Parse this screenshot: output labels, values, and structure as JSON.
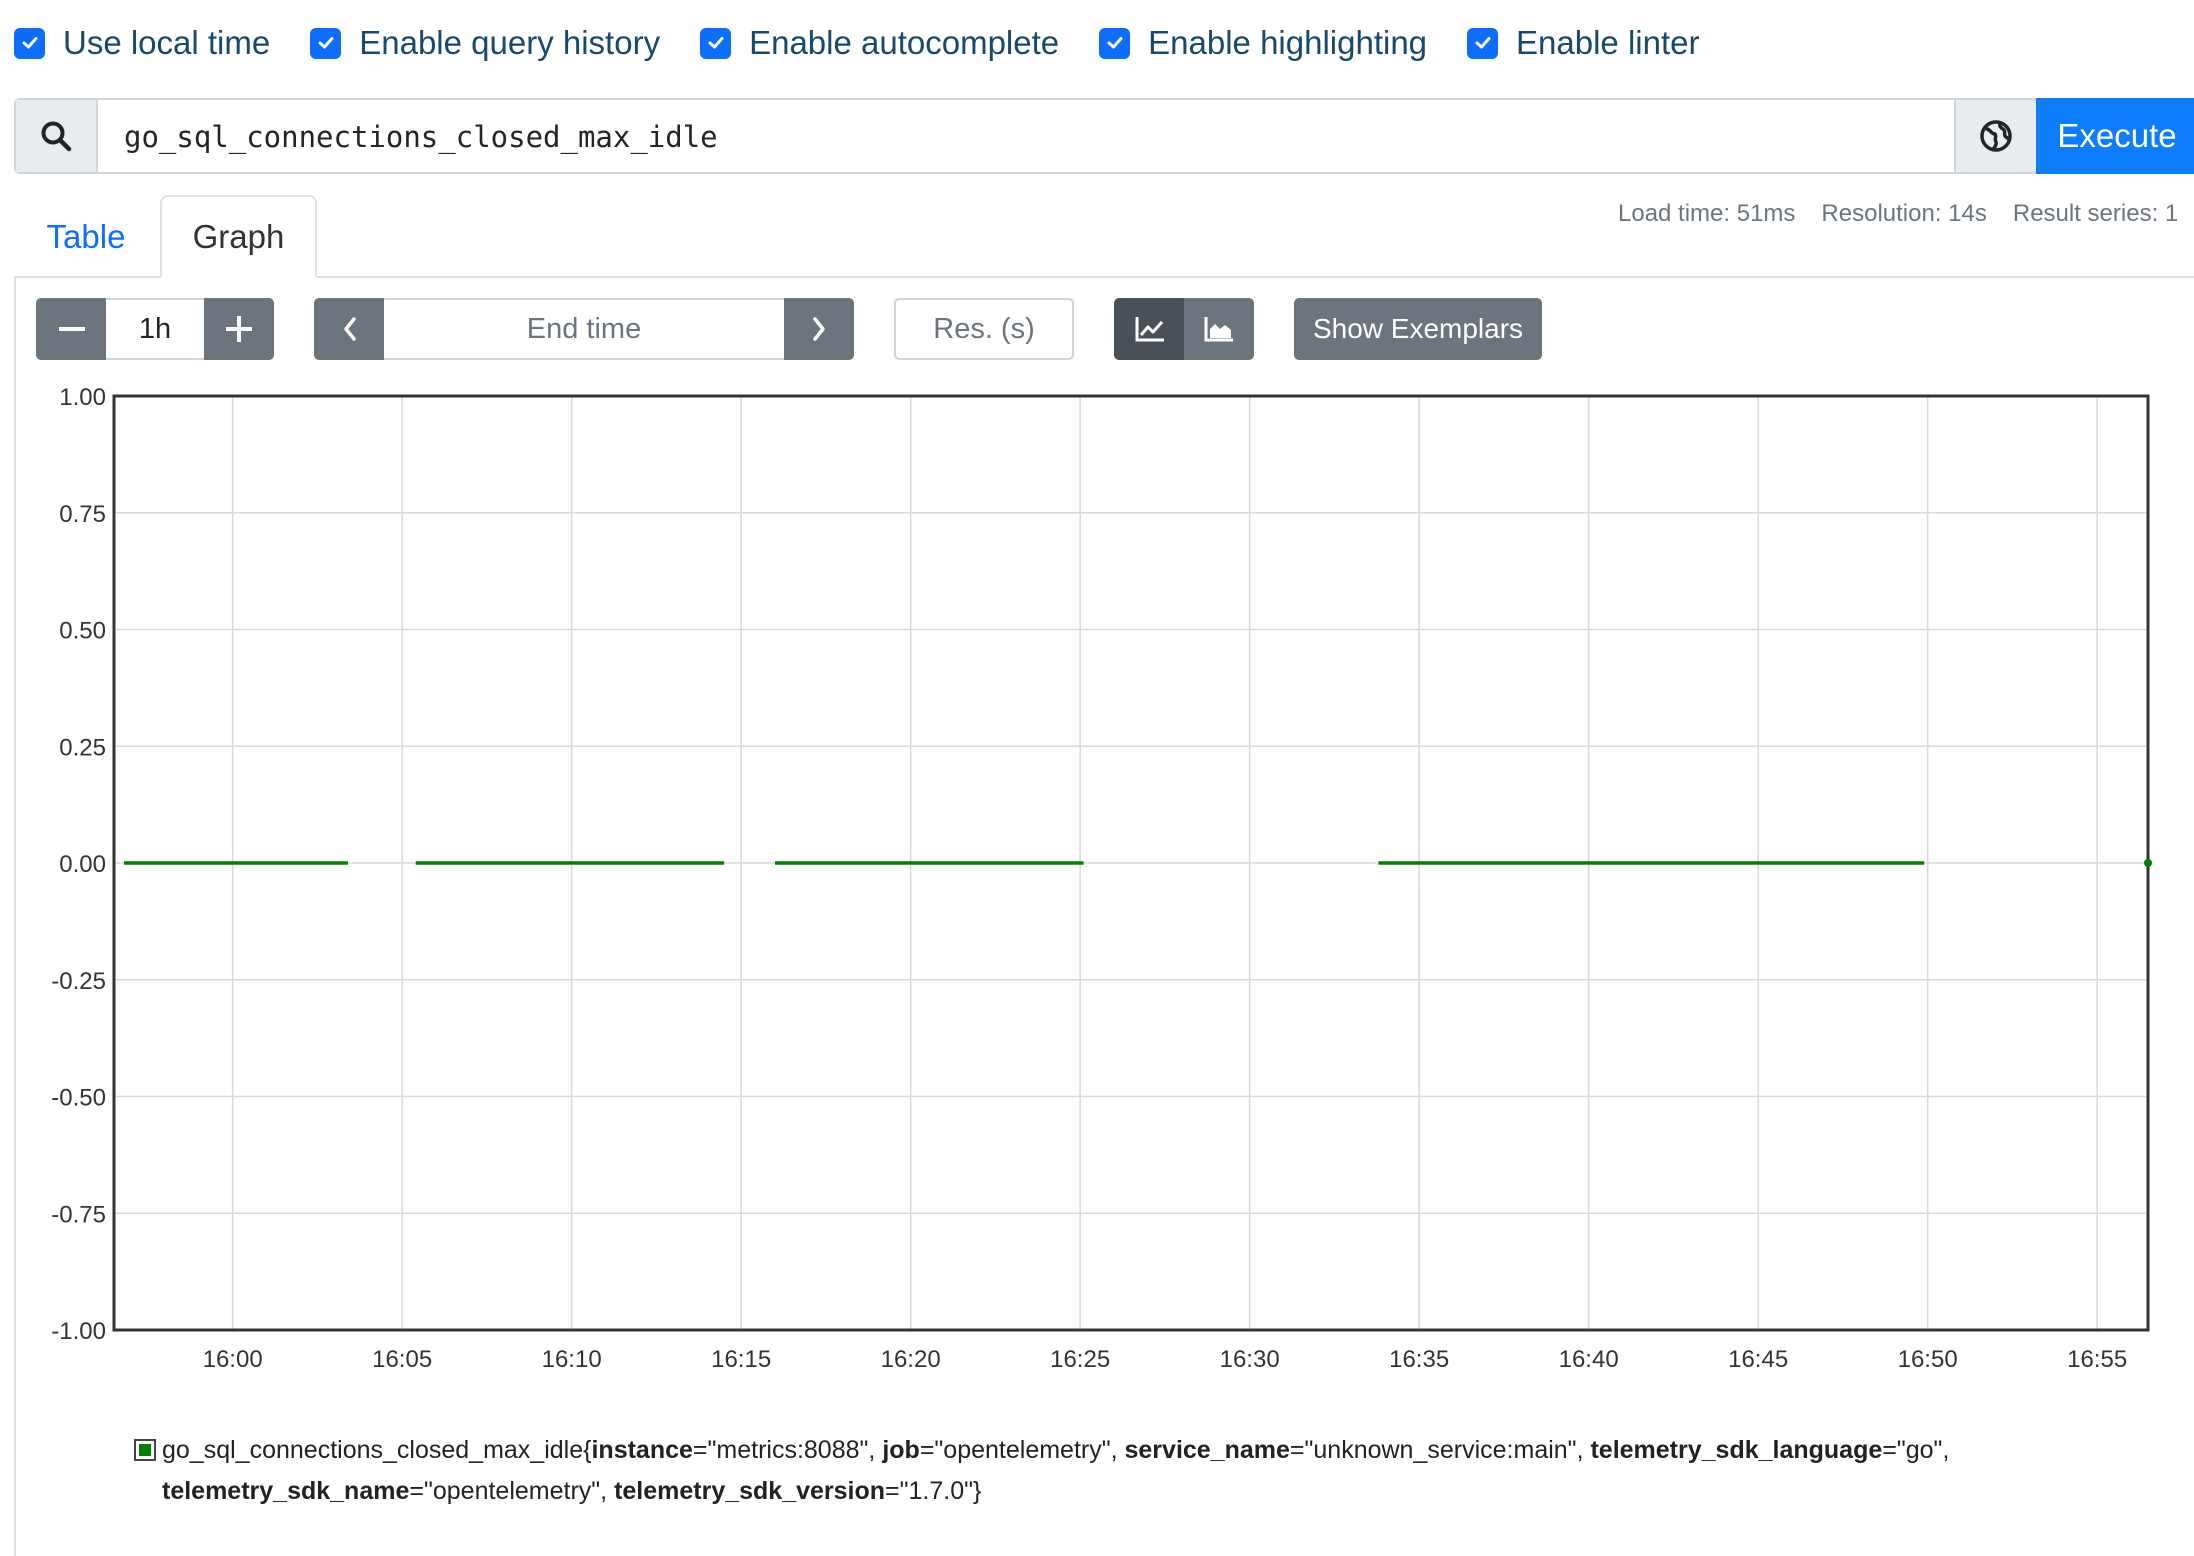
{
  "options": [
    {
      "label": "Use local time",
      "checked": true
    },
    {
      "label": "Enable query history",
      "checked": true
    },
    {
      "label": "Enable autocomplete",
      "checked": true
    },
    {
      "label": "Enable highlighting",
      "checked": true
    },
    {
      "label": "Enable linter",
      "checked": true
    }
  ],
  "query": {
    "expression": "go_sql_connections_closed_max_idle",
    "execute_label": "Execute"
  },
  "tabs": [
    {
      "label": "Table",
      "active": false
    },
    {
      "label": "Graph",
      "active": true
    }
  ],
  "stats": {
    "load_time": "Load time: 51ms",
    "resolution": "Resolution: 14s",
    "result_series": "Result series: 1"
  },
  "controls": {
    "range": "1h",
    "end_time_placeholder": "End time",
    "resolution_placeholder": "Res. (s)",
    "show_exemplars": "Show Exemplars"
  },
  "colors": {
    "accent": "#0d6efd",
    "series": "#008000",
    "button_dark": "#6c757d",
    "button_darker": "#495057"
  },
  "chart_data": {
    "type": "line",
    "ylim": [
      -1.0,
      1.0
    ],
    "y_ticks": [
      "1.00",
      "0.75",
      "0.50",
      "0.25",
      "0.00",
      "-0.25",
      "-0.50",
      "-0.75",
      "-1.00"
    ],
    "x_ticks": [
      "16:00",
      "16:05",
      "16:10",
      "16:15",
      "16:20",
      "16:25",
      "16:30",
      "16:35",
      "16:40",
      "16:45",
      "16:50",
      "16:55"
    ],
    "xlim": [
      "15:56.5",
      "16:56.5"
    ],
    "grid": true,
    "series": [
      {
        "name": "go_sql_connections_closed_max_idle",
        "segments": [
          {
            "x": [
              "15:56.3",
              "16:03.4"
            ],
            "y": 0
          },
          {
            "x": [
              "16:05.4",
              "16:14.5"
            ],
            "y": 0
          },
          {
            "x": [
              "16:16.0",
              "16:25.1"
            ],
            "y": 0
          },
          {
            "x": [
              "16:33.8",
              "16:49.9"
            ],
            "y": 0
          },
          {
            "x": [
              "16:56.5",
              "16:56.5"
            ],
            "y": 0
          }
        ]
      }
    ],
    "legend": {
      "metric": "go_sql_connections_closed_max_idle",
      "labels": [
        {
          "key": "instance",
          "value": "\"metrics:8088\""
        },
        {
          "key": "job",
          "value": "\"opentelemetry\""
        },
        {
          "key": "service_name",
          "value": "\"unknown_service:main\""
        },
        {
          "key": "telemetry_sdk_language",
          "value": "\"go\""
        },
        {
          "key": "telemetry_sdk_name",
          "value": "\"opentelemetry\""
        },
        {
          "key": "telemetry_sdk_version",
          "value": "\"1.7.0\""
        }
      ]
    }
  }
}
